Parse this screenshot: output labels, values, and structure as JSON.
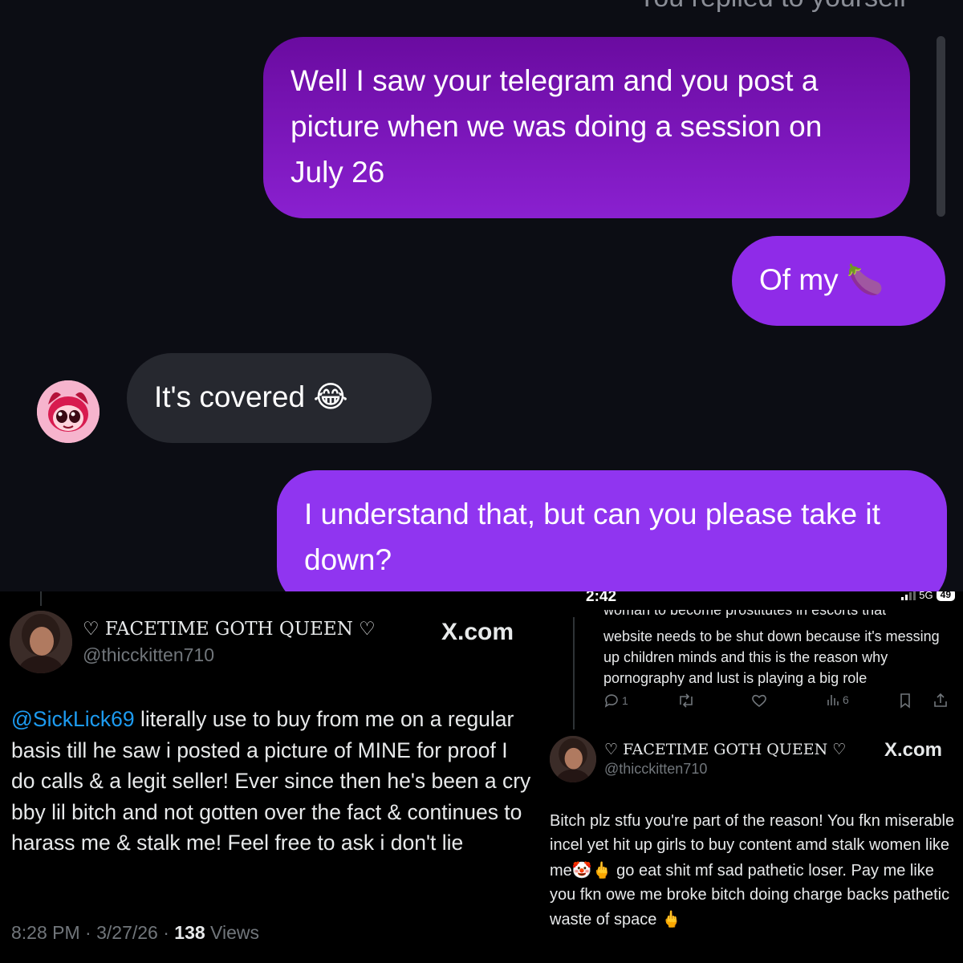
{
  "dm": {
    "header_cutoff": "You replied to yourself",
    "messages": [
      {
        "text": "Well I saw your telegram and you post a picture when we was doing a session on July 26",
        "emoji": "",
        "sender": "me"
      },
      {
        "text": "Of my ",
        "emoji": "🍆",
        "sender": "me"
      },
      {
        "text": "It's covered ",
        "emoji": "😂",
        "sender": "them"
      },
      {
        "text": "I understand that, but can you please take it down?",
        "emoji": "",
        "sender": "me"
      }
    ],
    "avatar_icon": "pink-cartoon-devil-avatar"
  },
  "tweet1": {
    "name": "♡ FACETIME GOTH QUEEN ♡",
    "handle": "@thicckitten710",
    "source": "X.com",
    "mention": "@SickLick69",
    "body": " literally use to buy from me on a regular basis till he saw i posted a picture of MINE for proof I do calls & a legit seller! Ever since then he's been a cry bby lil bitch and not gotten over the fact & continues to harass me & stalk me! Feel free to ask i don't  lie",
    "time": "8:28 PM · 3/27/26 · ",
    "views_count": "138",
    "views_label": " Views"
  },
  "phone": {
    "status_time": "2:42",
    "network": "5G",
    "battery": "49",
    "prev_tweet_cutoff": "woman to become prostitutes in escorts that",
    "prev_tweet_body": "website needs to be shut down because it's messing up children minds and this is the reason why pornography and lust is playing a big role",
    "actions": {
      "replies": "1",
      "views": "6"
    },
    "tweet2": {
      "name": "♡ FACETIME GOTH QUEEN ♡",
      "handle": "@thicckitten710",
      "source": "X.com",
      "body_part1": "Bitch plz stfu you're part of the reason! You fkn miserable incel yet hit up girls to buy content amd stalk women like me",
      "emoji1": "🤡🖕",
      "body_part2": " go eat shit mf sad pathetic loser. Pay me like you fkn owe me broke bitch doing charge backs pathetic waste of space ",
      "emoji2": "🖕"
    }
  },
  "colors": {
    "dm_background": "#0c0d14",
    "bubble_purple_dark": "#6a0ba0",
    "bubble_purple": "#8f2be8",
    "bubble_gray": "#26282f",
    "link_blue": "#1d9bf0",
    "muted_gray": "#71767b"
  }
}
